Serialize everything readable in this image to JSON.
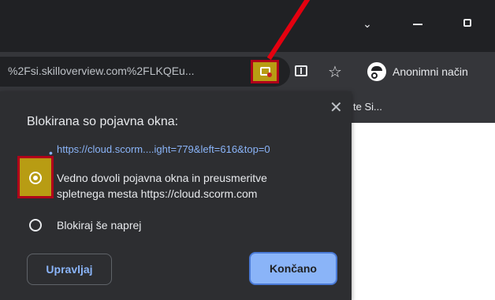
{
  "browser": {
    "url": "%2Fsi.skilloverview.com%2FLKQEu...",
    "profile_label": "Anonimni način",
    "bookmark_label": "te Si...",
    "window_controls": {
      "chevron_glyph": "⌄"
    }
  },
  "dialog": {
    "title": "Blokirana so pojavna okna:",
    "close_glyph": "✕",
    "blocked_link": "https://cloud.scorm....ight=779&left=616&top=0",
    "option_allow_line1": "Vedno dovoli pojavna okna in preusmeritve",
    "option_allow_line2": "spletnega mesta https://cloud.scorm.com",
    "option_block": "Blokiraj še naprej",
    "selected_option": "allow",
    "manage_button": "Upravljaj",
    "done_button": "Končano"
  },
  "icons": [
    "popup-blocked-icon",
    "translate-icon",
    "star-icon",
    "incognito-icon",
    "close-icon"
  ],
  "colors": {
    "highlight": "#b89c13",
    "annotation_red": "#e4000f",
    "accent_blue": "#8ab4f8"
  }
}
